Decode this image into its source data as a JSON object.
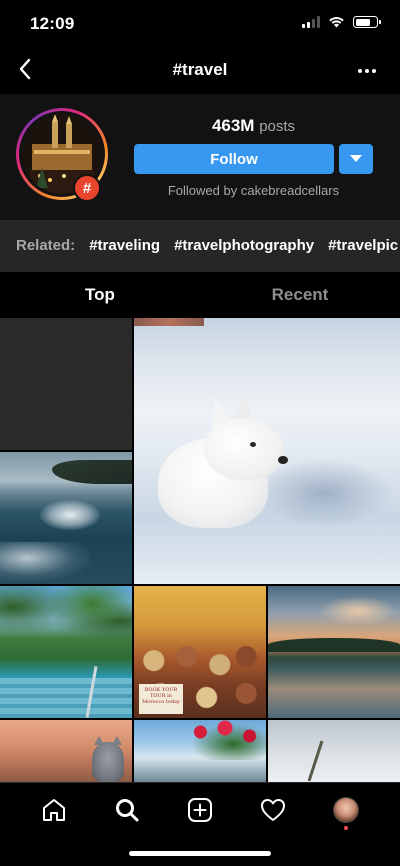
{
  "status_bar": {
    "time": "12:09"
  },
  "nav": {
    "title": "#travel"
  },
  "header": {
    "posts_count": "463M",
    "posts_word": "posts",
    "follow_label": "Follow",
    "followed_by": "Followed by cakebreadcellars",
    "badge_symbol": "#"
  },
  "related": {
    "label": "Related:",
    "tags": [
      "#traveling",
      "#travelphotography",
      "#travelpic"
    ]
  },
  "tabs": [
    {
      "label": "Top",
      "active": true
    },
    {
      "label": "Recent",
      "active": false
    }
  ],
  "sign_text": "BOOK YOUR TOUR in Morocco today",
  "icons": {
    "back": "chevron-left-icon",
    "more": "more-horizontal-icon",
    "dropdown": "chevron-down-icon",
    "home": "home-icon",
    "search": "search-icon",
    "add": "add-post-icon",
    "activity": "heart-icon",
    "profile": "profile-avatar"
  },
  "colors": {
    "accent": "#3897f0",
    "badge": "#e8452c",
    "notification": "#ed4956"
  }
}
